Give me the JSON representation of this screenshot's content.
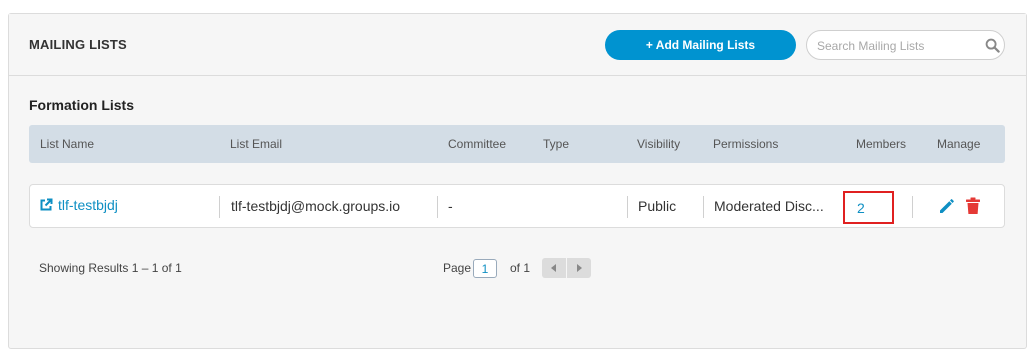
{
  "header": {
    "title": "MAILING LISTS",
    "add_button_label": "+ Add Mailing Lists",
    "search_placeholder": "Search Mailing Lists"
  },
  "section": {
    "title": "Formation Lists"
  },
  "table": {
    "columns": [
      "List Name",
      "List Email",
      "Committee",
      "Type",
      "Visibility",
      "Permissions",
      "Members",
      "Manage"
    ],
    "rows": [
      {
        "list_name": "tlf-testbjdj",
        "list_email": "tlf-testbjdj@mock.groups.io",
        "committee": "-",
        "type": "",
        "visibility": "Public",
        "permissions": "Moderated Disc...",
        "members": "2",
        "manage_icons": [
          "pencil-icon",
          "trash-icon"
        ]
      }
    ]
  },
  "footer": {
    "results_text": "Showing Results 1 – 1 of 1",
    "page_label": "Page",
    "page_value": "1",
    "of_label": "of 1"
  },
  "colors": {
    "primary": "#0093d0",
    "link": "#0e8fc3",
    "delete": "#e53935",
    "highlight": "#e02020",
    "table_header_bg": "#d3dde6"
  }
}
